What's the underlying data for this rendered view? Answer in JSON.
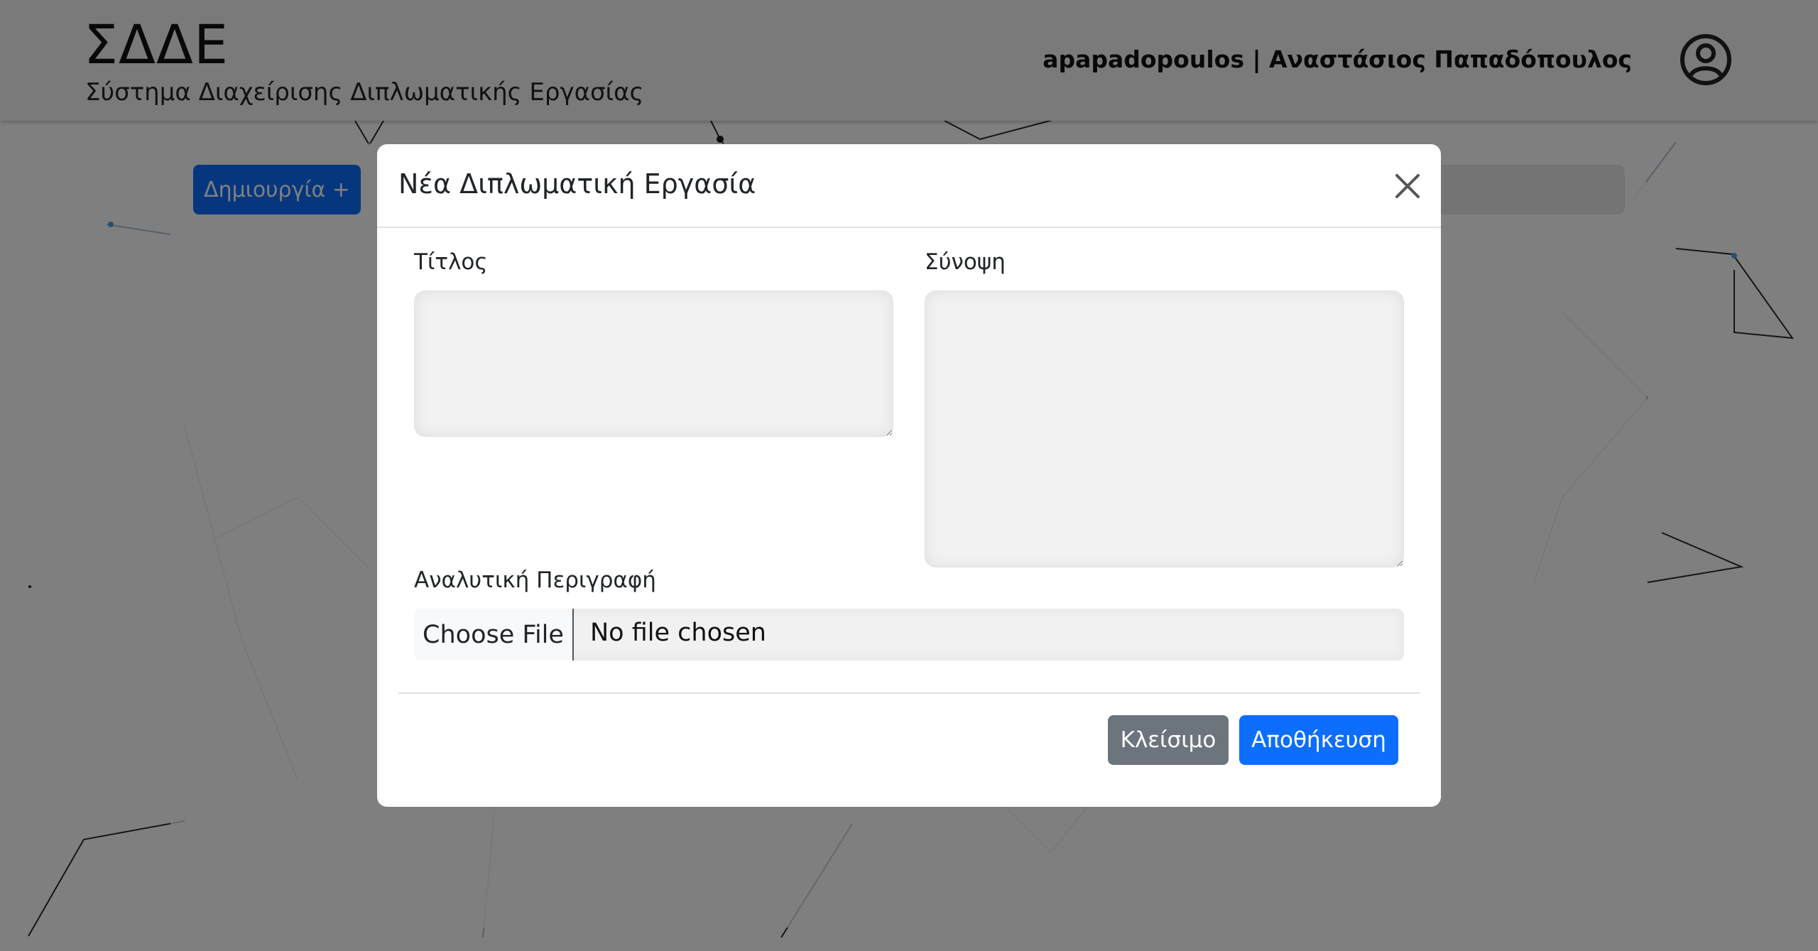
{
  "header": {
    "title": "ΣΔΔΕ",
    "subtitle": "Σύστημα Διαχείρισης Διπλωματικής Εργασίας",
    "user": "apapadopoulos | Αναστάσιος Παπαδόπουλος",
    "user_icon": "user-circle-icon"
  },
  "main": {
    "create_button": "Δημιουργία +"
  },
  "modal": {
    "title": "Νέα Διπλωματική Εργασία",
    "close_icon": "close-icon",
    "fields": {
      "title_label": "Τίτλος",
      "title_value": "",
      "summary_label": "Σύνοψη",
      "summary_value": "",
      "description_label": "Αναλυτική Περιγραφή",
      "file_button": "Choose File",
      "file_status": "No file chosen"
    },
    "buttons": {
      "close": "Κλείσιμο",
      "save": "Αποθήκευση"
    }
  },
  "colors": {
    "primary": "#0d6efd",
    "secondary": "#6c757d"
  }
}
